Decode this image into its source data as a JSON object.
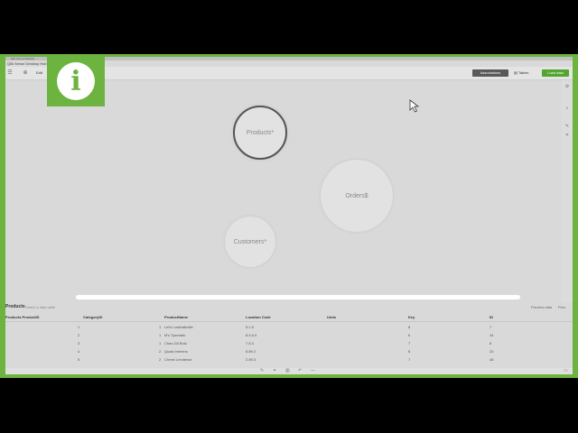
{
  "app": {
    "window_title": "Qlik Sense Desktop",
    "subtitle": "Qlik Sense Desktop Hub"
  },
  "toolbar": {
    "edit_label": "Edit",
    "view_label": "Data",
    "associations_label": "Associations",
    "tables_label": "Tables",
    "load_label": "Load data"
  },
  "bubbles": [
    {
      "label": "Products*",
      "selected": true
    },
    {
      "label": "Orders$",
      "selected": false
    },
    {
      "label": "Customers*",
      "selected": false
    }
  ],
  "preview": {
    "title": "Products",
    "hint": "Select a data table",
    "right_label": "Preview data",
    "right_label2": "Prev"
  },
  "table": {
    "columns": [
      "Products.ProductID",
      "CategoryID",
      "ProductName",
      "Location Code",
      "Units",
      "Key",
      "ID"
    ],
    "rows": [
      [
        "1",
        "1",
        "Let's Lambalkeille",
        "5.1.5",
        "",
        "8",
        "7"
      ],
      [
        "2",
        "1",
        "M's Tysedark",
        "8.4.6.9",
        "",
        "6",
        "44"
      ],
      [
        "3",
        "1",
        "Chao-Gil Bolo",
        "7.6.3",
        "",
        "7",
        "8"
      ],
      [
        "4",
        "2",
        "Quasi Immens",
        "8.89.2",
        "",
        "8",
        "33"
      ],
      [
        "5",
        "2",
        "Chrest Lendense",
        "2.89.3",
        "",
        "7",
        "48"
      ]
    ]
  },
  "colors": {
    "frame_green": "#6cb33f",
    "app_bg": "#d9d9d9",
    "associations_bg": "#595959",
    "load_bg": "#52a52e"
  },
  "icons": {
    "info": "info-icon",
    "cursor": "mouse-cursor-icon"
  },
  "info_glyph": "i"
}
